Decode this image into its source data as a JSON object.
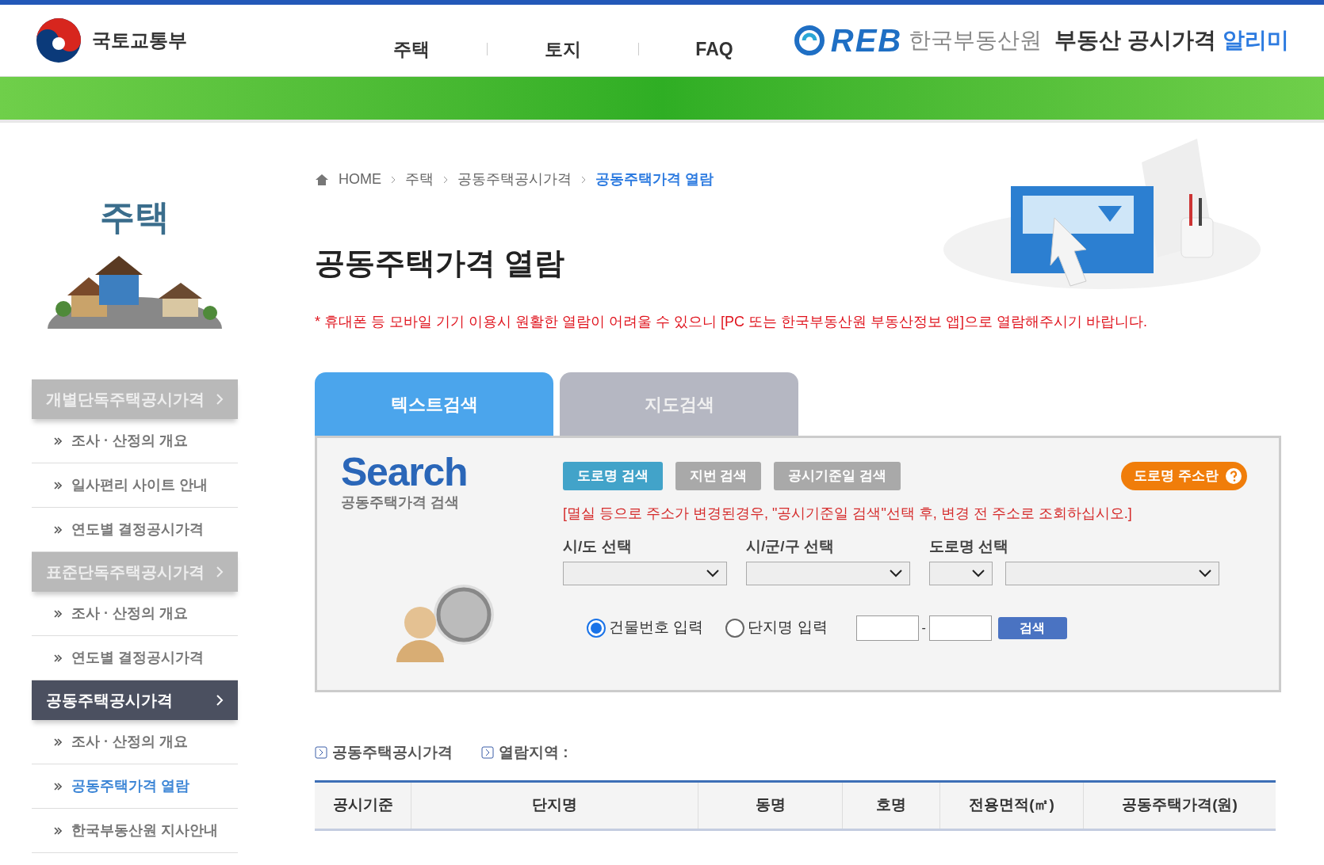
{
  "header": {
    "ministry": "국토교통부",
    "nav": [
      {
        "label": "주택",
        "selected": false
      },
      {
        "label": "토지",
        "selected": false
      },
      {
        "label": "FAQ",
        "selected": false
      }
    ],
    "brand": {
      "logo": "REB",
      "org": "한국부동산원",
      "service": "부동산 공시가격",
      "service_highlight": "알리미"
    }
  },
  "sidebar": {
    "title": "주택",
    "groups": [
      {
        "label": "개별단독주택공시가격",
        "selected": false,
        "items": [
          {
            "label": "조사 · 산정의 개요",
            "selected": false
          },
          {
            "label": "일사편리 사이트 안내",
            "selected": false
          },
          {
            "label": "연도별 결정공시가격",
            "selected": false
          }
        ]
      },
      {
        "label": "표준단독주택공시가격",
        "selected": false,
        "items": [
          {
            "label": "조사 · 산정의 개요",
            "selected": false
          },
          {
            "label": "연도별 결정공시가격",
            "selected": false
          }
        ]
      },
      {
        "label": "공동주택공시가격",
        "selected": true,
        "items": [
          {
            "label": "조사 · 산정의 개요",
            "selected": false
          },
          {
            "label": "공동주택가격 열람",
            "selected": true
          },
          {
            "label": "한국부동산원 지사안내",
            "selected": false
          }
        ]
      }
    ]
  },
  "breadcrumb": [
    "HOME",
    "주택",
    "공동주택공시가격",
    "공동주택가격 열람"
  ],
  "page_title": "공동주택가격 열람",
  "notice": "* 휴대폰 등 모바일 기기 이용시 원활한 열람이 어려울 수 있으니 [PC 또는 한국부동산원 부동산정보 앱]으로 열람해주시기 바랍니다.",
  "tabs": [
    {
      "label": "텍스트검색",
      "selected": true
    },
    {
      "label": "지도검색",
      "selected": false
    }
  ],
  "search_panel": {
    "heading": "Search",
    "subheading": "공동주택가격 검색",
    "modes": [
      {
        "label": "도로명 검색",
        "selected": true
      },
      {
        "label": "지번 검색",
        "selected": false
      },
      {
        "label": "공시기준일 검색",
        "selected": false
      }
    ],
    "help_button": "도로명 주소란",
    "warning": "[멸실 등으로 주소가 변경된경우, \"공시기준일 검색\"선택 후, 변경 전 주소로 조회하십시오.]",
    "selects": [
      {
        "label": "시/도 선택"
      },
      {
        "label": "시/군/구 선택"
      },
      {
        "label": "도로명 선택"
      }
    ],
    "radios": [
      {
        "label": "건물번호 입력",
        "selected": true
      },
      {
        "label": "단지명 입력",
        "selected": false
      }
    ],
    "separator": "-",
    "search_button": "검색"
  },
  "result_labels": [
    "공동주택공시가격",
    "열람지역 :"
  ],
  "table": {
    "columns": [
      "공시기준",
      "단지명",
      "동명",
      "호명",
      "전용면적(㎡)",
      "공동주택가격(원)"
    ]
  }
}
